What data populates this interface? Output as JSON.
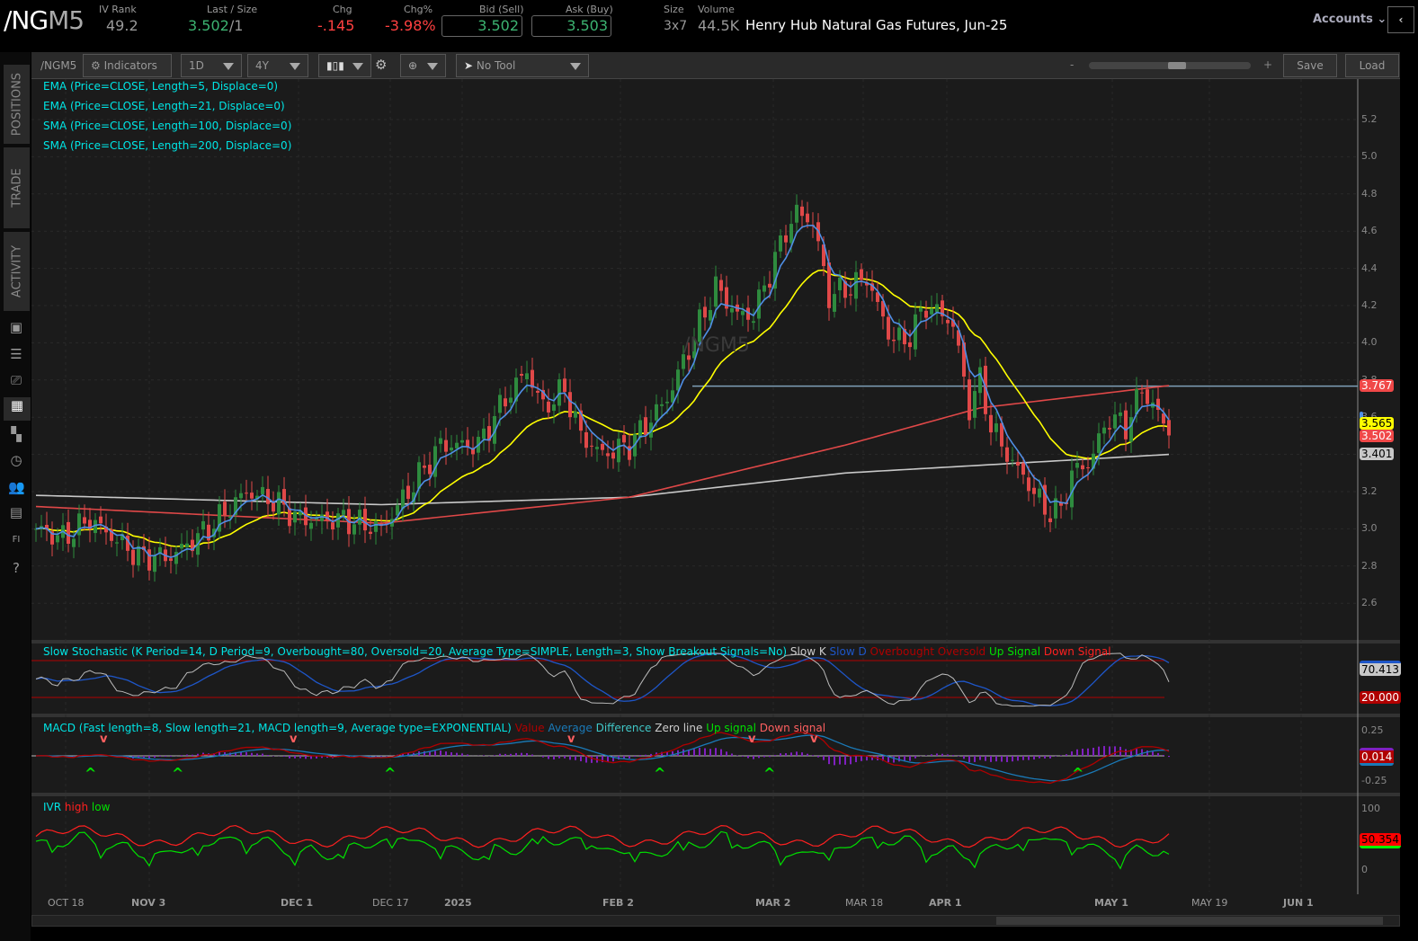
{
  "header": {
    "symbol_main": "/NG",
    "symbol_suffix": "M5",
    "iv_rank_label": "IV Rank",
    "iv_rank": "49.2",
    "last_label": "Last / Size",
    "last": "3.502",
    "size": "/1",
    "chg_label": "Chg",
    "chg": "-.145",
    "chgpct_label": "Chg%",
    "chgpct": "-3.98%",
    "bid_label": "Bid (Sell)",
    "bid": "3.502",
    "ask_label": "Ask (Buy)",
    "ask": "3.503",
    "size_label": "Size",
    "size_val": "3x7",
    "volume_label": "Volume",
    "volume": "44.5K",
    "description": "Henry Hub Natural Gas Futures, Jun-25",
    "accounts": "Accounts"
  },
  "toolbar": {
    "symbol": "/NGM5",
    "indicators": "Indicators",
    "aggregation": "1D",
    "timeframe": "4Y",
    "tool": "No Tool",
    "zoom_minus": "-",
    "zoom_plus": "+",
    "save": "Save",
    "load": "Load",
    "zoom_level": 0.55
  },
  "sidebar": {
    "tabs": [
      "POSITIONS",
      "TRADE",
      "ACTIVITY"
    ]
  },
  "studies": {
    "ema5": "EMA (Price=CLOSE, Length=5, Displace=0)",
    "ema21": "EMA (Price=CLOSE, Length=21, Displace=0)",
    "sma100": "SMA (Price=CLOSE, Length=100, Displace=0)",
    "sma200": "SMA (Price=CLOSE, Length=200, Displace=0)",
    "watermark": "/NGM5"
  },
  "stoch": {
    "title": "Slow Stochastic (K Period=14, D Period=9, Overbought=80, Oversold=20, Average Type=SIMPLE, Length=3, Show Breakout Signals=No)",
    "legend": [
      "Slow K",
      "Slow D",
      "Overbought",
      "Oversold",
      "Up Signal",
      "Down Signal"
    ],
    "k_value": "70.413",
    "oversold_value": "20.000"
  },
  "macd": {
    "title": "MACD (Fast length=8, Slow length=21, MACD length=9, Average type=EXPONENTIAL)",
    "legend": [
      "Value",
      "Average",
      "Difference",
      "Zero line",
      "Up signal",
      "Down signal"
    ],
    "value": "0.014",
    "ticks": [
      "0.25",
      "-0.25"
    ]
  },
  "ivr": {
    "title": "IVR",
    "legend": [
      "high",
      "low"
    ],
    "value": "50.354",
    "ticks": [
      "100",
      "0"
    ]
  },
  "price_tags": {
    "sma100": "3.767",
    "ema21": "3.565",
    "last": "3.502",
    "sma200": "3.401"
  },
  "colors": {
    "up": "#2e8b3e",
    "down": "#e04848",
    "ema5": "#4f8fe6",
    "ema21": "#ffff00",
    "sma100": "#e04848",
    "sma200": "#c8c8c8"
  },
  "chart_data": {
    "type": "candlestick",
    "title": "/NGM5 1D",
    "y_ticks": [
      "5.2",
      "5.0",
      "4.8",
      "4.6",
      "4.4",
      "4.2",
      "4.0",
      "3.8",
      "3.6",
      "3.4",
      "3.2",
      "3.0",
      "2.8",
      "2.6"
    ],
    "ylim": [
      2.5,
      5.3
    ],
    "x_ticks": [
      "OCT 18",
      "NOV 3",
      "DEC 1",
      "DEC 17",
      "2025",
      "FEB 2",
      "MAR 2",
      "MAR 18",
      "APR 1",
      "MAY 1",
      "MAY 19",
      "JUN 1"
    ],
    "close_keypoints": [
      [
        0,
        3.0
      ],
      [
        5,
        2.95
      ],
      [
        10,
        3.05
      ],
      [
        19,
        2.85
      ],
      [
        25,
        2.85
      ],
      [
        32,
        3.0
      ],
      [
        39,
        3.2
      ],
      [
        44,
        3.15
      ],
      [
        49,
        3.05
      ],
      [
        57,
        3.05
      ],
      [
        64,
        3.0
      ],
      [
        69,
        3.2
      ],
      [
        75,
        3.45
      ],
      [
        82,
        3.45
      ],
      [
        87,
        3.7
      ],
      [
        91,
        3.85
      ],
      [
        94,
        3.65
      ],
      [
        98,
        3.75
      ],
      [
        101,
        3.5
      ],
      [
        105,
        3.4
      ],
      [
        110,
        3.45
      ],
      [
        117,
        3.7
      ],
      [
        123,
        4.1
      ],
      [
        126,
        4.3
      ],
      [
        130,
        4.15
      ],
      [
        133,
        4.15
      ],
      [
        135,
        4.3
      ],
      [
        139,
        4.6
      ],
      [
        141,
        4.7
      ],
      [
        144,
        4.65
      ],
      [
        147,
        4.25
      ],
      [
        151,
        4.3
      ],
      [
        154,
        4.35
      ],
      [
        158,
        4.05
      ],
      [
        161,
        4.0
      ],
      [
        165,
        4.2
      ],
      [
        168,
        4.15
      ],
      [
        170,
        4.1
      ],
      [
        173,
        3.65
      ],
      [
        175,
        3.8
      ],
      [
        177,
        3.55
      ],
      [
        180,
        3.4
      ],
      [
        185,
        3.2
      ],
      [
        187,
        3.1
      ],
      [
        190,
        3.1
      ],
      [
        192,
        3.3
      ],
      [
        195,
        3.35
      ],
      [
        199,
        3.6
      ],
      [
        202,
        3.55
      ],
      [
        205,
        3.75
      ],
      [
        208,
        3.62
      ],
      [
        210,
        3.5
      ]
    ],
    "sma100_keypoints": [
      [
        0,
        3.12
      ],
      [
        64,
        3.03
      ],
      [
        110,
        3.17
      ],
      [
        150,
        3.45
      ],
      [
        175,
        3.65
      ],
      [
        210,
        3.77
      ]
    ],
    "sma200_keypoints": [
      [
        0,
        3.18
      ],
      [
        64,
        3.13
      ],
      [
        110,
        3.17
      ],
      [
        150,
        3.3
      ],
      [
        210,
        3.4
      ]
    ]
  }
}
